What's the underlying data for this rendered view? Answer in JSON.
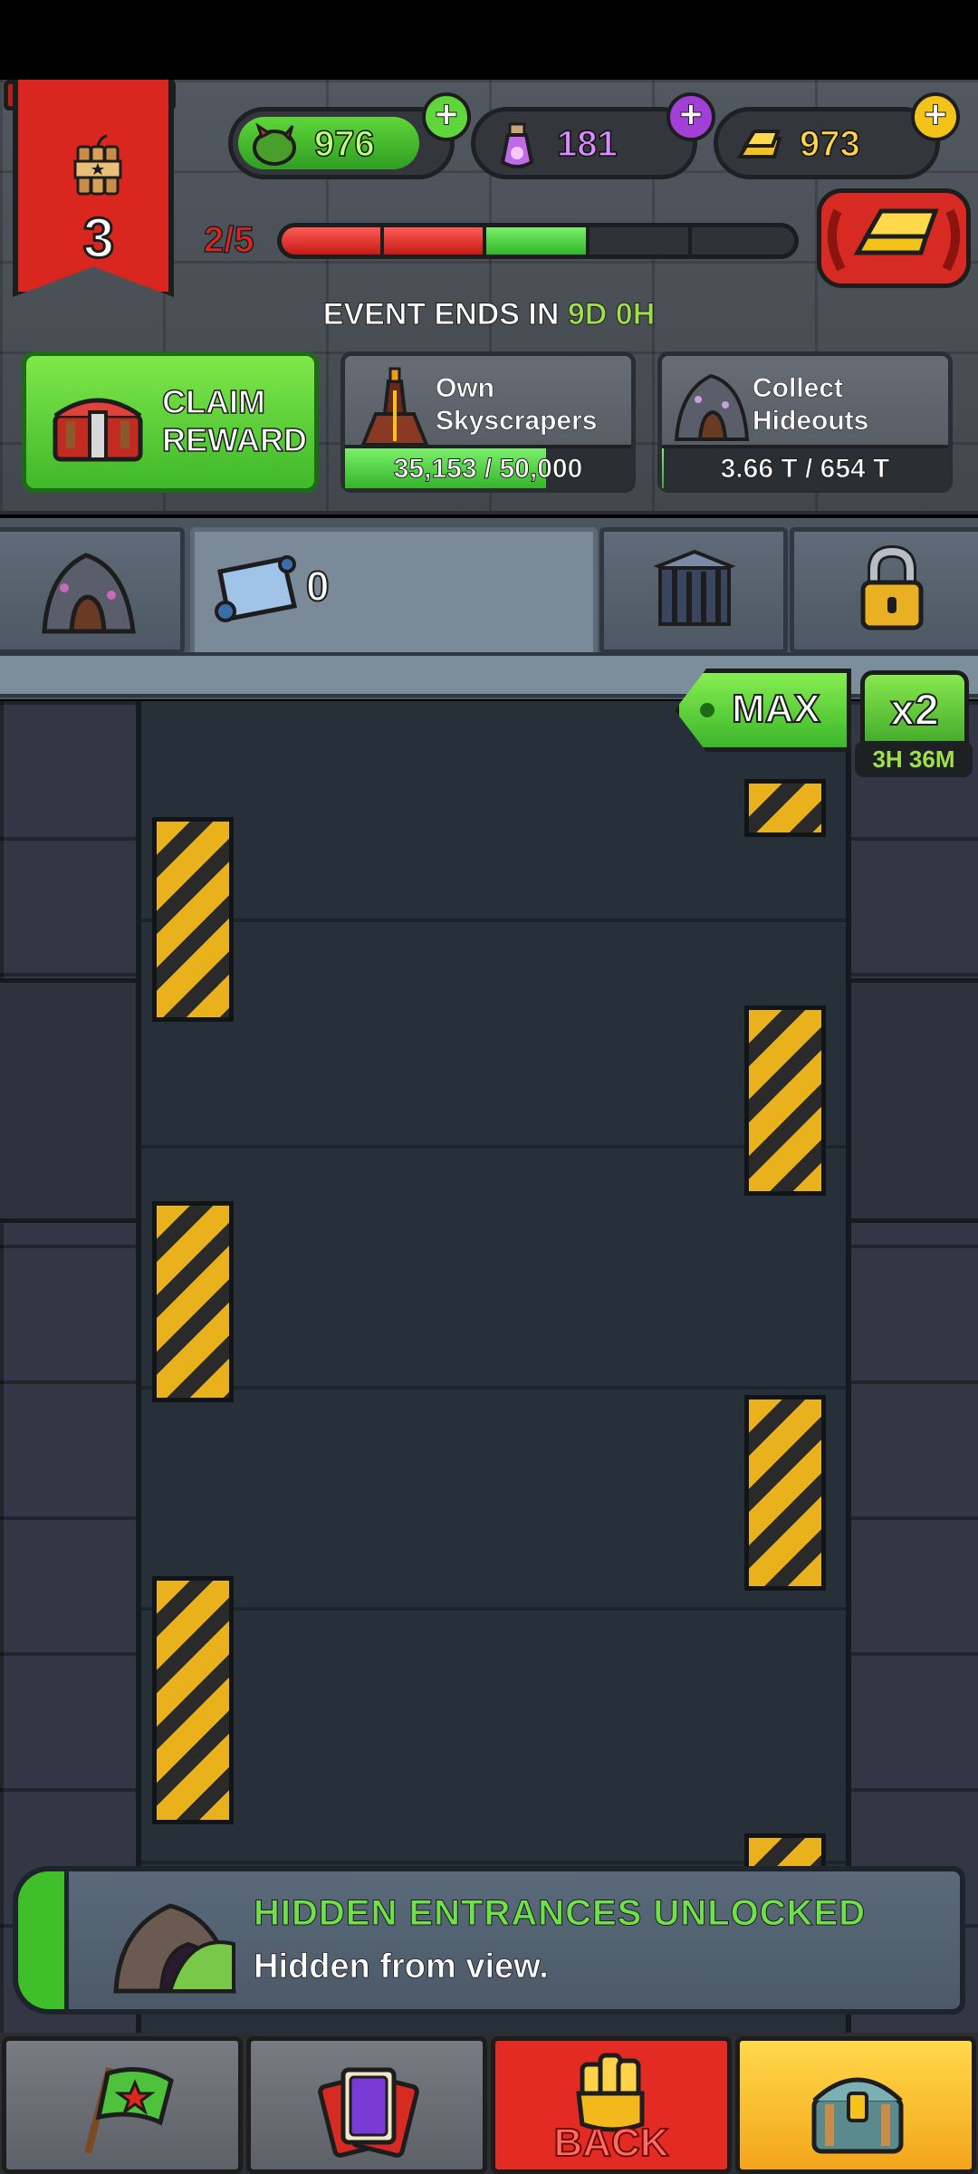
{
  "hud": {
    "level": "3",
    "currencies": {
      "cash": "976",
      "potion": "181",
      "gold": "973"
    },
    "progress": {
      "label": "2/5",
      "completed": 2,
      "total": 5
    },
    "event_ends": {
      "prefix": "EVENT ENDS IN",
      "time": "9D 0H"
    }
  },
  "tasks": {
    "claim": {
      "label": "CLAIM\nREWARD"
    },
    "skyscrapers": {
      "title": "Own\nSkyscrapers",
      "progress": "35,153 / 50,000",
      "fraction": 0.703
    },
    "hideouts": {
      "title": "Collect\nHideouts",
      "progress": "3.66 T / 654 T",
      "fraction": 0.0056
    }
  },
  "tabs": {
    "blueprint_count": "0"
  },
  "boost": {
    "max_label": "MAX",
    "multiplier": "x2",
    "timer": "3H 36M"
  },
  "notification": {
    "title": "HIDDEN ENTRANCES UNLOCKED",
    "subtitle": "Hidden from view."
  },
  "nav": {
    "back_label": "BACK"
  },
  "colors": {
    "accent_green": "#3fb82a",
    "danger_red": "#d9261f",
    "gold": "#f3c21b",
    "purple": "#a23fd6"
  }
}
